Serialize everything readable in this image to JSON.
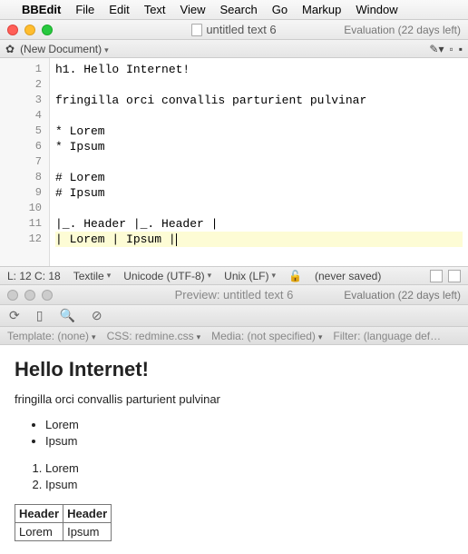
{
  "menubar": {
    "items": [
      "BBEdit",
      "File",
      "Edit",
      "Text",
      "View",
      "Search",
      "Go",
      "Markup",
      "Window"
    ]
  },
  "title": {
    "text": "untitled text 6",
    "eval": "Evaluation (22 days left)"
  },
  "subbar": {
    "label": "(New Document)"
  },
  "editor": {
    "lines": [
      "h1. Hello Internet!",
      "",
      "fringilla orci convallis parturient pulvinar",
      "",
      "* Lorem",
      "* Ipsum",
      "",
      "# Lorem",
      "# Ipsum",
      "",
      "|_. Header |_. Header |",
      "| Lorem | Ipsum |"
    ],
    "line_count": 12,
    "highlight_line": 12
  },
  "status": {
    "pos": "L: 12 C: 18",
    "lang": "Textile",
    "enc": "Unicode (UTF-8)",
    "eol": "Unix (LF)",
    "saved": "(never saved)"
  },
  "previewbar": {
    "title": "Preview: untitled text 6",
    "eval": "Evaluation (22 days left)"
  },
  "filters": {
    "template": "Template: (none)",
    "css": "CSS: redmine.css",
    "media": "Media: (not specified)",
    "filter": "Filter: (language def…"
  },
  "preview": {
    "h1": "Hello Internet!",
    "p": "fringilla orci convallis parturient pulvinar",
    "ul": [
      "Lorem",
      "Ipsum"
    ],
    "ol": [
      "Lorem",
      "Ipsum"
    ],
    "th": [
      "Header",
      "Header"
    ],
    "td": [
      "Lorem",
      "Ipsum"
    ]
  }
}
